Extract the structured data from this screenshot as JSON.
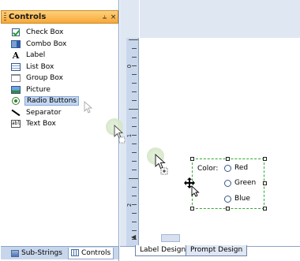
{
  "panel": {
    "title": "Controls",
    "pin_glyph": "⫨",
    "close_glyph": "×",
    "items": [
      {
        "label": "Check Box",
        "icon": "check-box-icon"
      },
      {
        "label": "Combo Box",
        "icon": "combo-box-icon"
      },
      {
        "label": "Label",
        "icon": "label-icon"
      },
      {
        "label": "List Box",
        "icon": "list-box-icon"
      },
      {
        "label": "Group Box",
        "icon": "group-box-icon"
      },
      {
        "label": "Picture",
        "icon": "picture-icon"
      },
      {
        "label": "Radio Buttons",
        "icon": "radio-button-icon",
        "selected": true
      },
      {
        "label": "Separator",
        "icon": "separator-icon"
      },
      {
        "label": "Text Box",
        "icon": "text-box-icon",
        "glyph": "abl"
      }
    ],
    "tabs": [
      {
        "label": "Sub-Strings"
      },
      {
        "label": "Controls",
        "active": true
      }
    ]
  },
  "ruler": {
    "labels": [
      "0",
      "1",
      "2"
    ]
  },
  "canvas": {
    "group": {
      "label": "Color:",
      "options": [
        "Red",
        "Green",
        "Blue"
      ]
    }
  },
  "design_tabs": [
    {
      "label": "Label Design",
      "active": true
    },
    {
      "label": "Prompt Design",
      "active": false
    }
  ],
  "colors": {
    "panel_header": "#f7a83a",
    "selection_highlight": "#c3d6f2",
    "selection_dash": "#33a833",
    "chrome_blue": "#c9d7ec"
  }
}
